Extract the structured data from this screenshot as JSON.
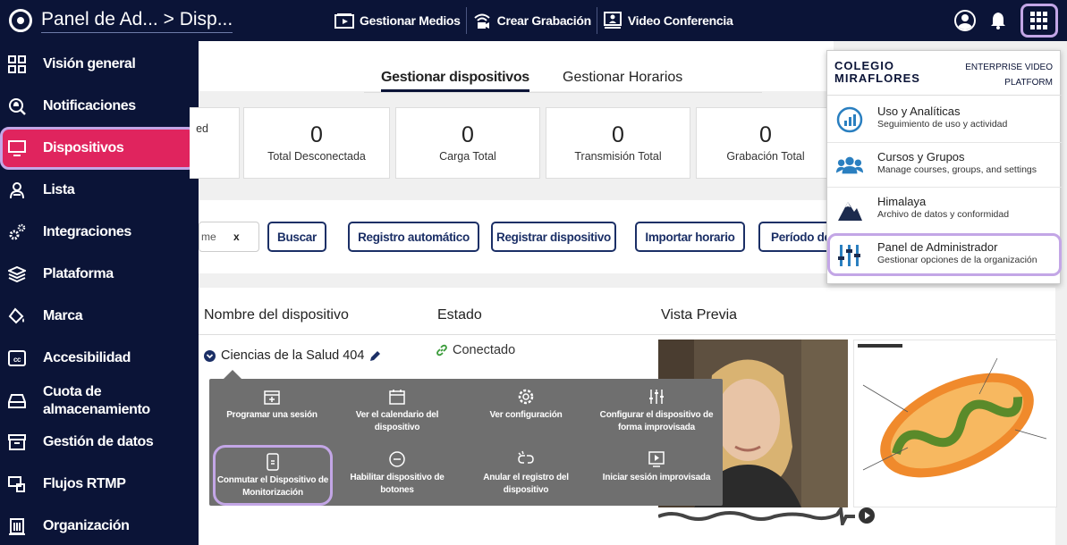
{
  "header": {
    "brand_title": "Panel de Ad...  > Disp...",
    "links": [
      "Gestionar Medios",
      "Crear Grabación",
      "Video Conferencia"
    ]
  },
  "sidebar": {
    "items": [
      {
        "label": "Visión general",
        "icon": "grid-icon"
      },
      {
        "label": "Notificaciones",
        "icon": "bell-search-icon"
      },
      {
        "label": "Dispositivos",
        "icon": "monitor-icon"
      },
      {
        "label": "Lista",
        "icon": "roster-icon"
      },
      {
        "label": "Integraciones",
        "icon": "gears-icon"
      },
      {
        "label": "Plataforma",
        "icon": "layers-icon"
      },
      {
        "label": "Marca",
        "icon": "paint-icon"
      },
      {
        "label": "Accesibilidad",
        "icon": "cc-icon"
      },
      {
        "label": "Cuota de almacenamiento",
        "icon": "drive-icon"
      },
      {
        "label": "Gestión de datos",
        "icon": "archive-icon"
      },
      {
        "label": "Flujos RTMP",
        "icon": "stream-icon"
      },
      {
        "label": "Organización",
        "icon": "building-icon"
      }
    ],
    "active_index": 2
  },
  "tabs": [
    "Gestionar dispositivos",
    "Gestionar Horarios"
  ],
  "stats": [
    {
      "value": "",
      "label": "ed"
    },
    {
      "value": "0",
      "label": "Total Desconectada"
    },
    {
      "value": "0",
      "label": "Carga Total"
    },
    {
      "value": "0",
      "label": "Transmisión Total"
    },
    {
      "value": "0",
      "label": "Grabación Total"
    }
  ],
  "filter_chip": {
    "text": "me",
    "clear": "x"
  },
  "buttons": [
    "Buscar",
    "Registro automático",
    "Registrar dispositivo",
    "Importar horario",
    "Período de"
  ],
  "table": {
    "headers": [
      "Nombre del dispositivo",
      "Estado",
      "Vista Previa"
    ],
    "row": {
      "name": "Ciencias de la Salud 404",
      "status": "Conectado"
    }
  },
  "popover": {
    "items": [
      {
        "label": "Programar una sesión",
        "icon": "calendar-plus-icon"
      },
      {
        "label": "Ver el calendario del dispositivo",
        "icon": "calendar-icon"
      },
      {
        "label": "Ver configuración",
        "icon": "gear-icon"
      },
      {
        "label": "Configurar el dispositivo de forma improvisada",
        "icon": "sliders-icon"
      },
      {
        "label": "Conmutar el Dispositivo de Monitorización",
        "icon": "phone-icon"
      },
      {
        "label": "Habilitar dispositivo de botones",
        "icon": "minus-circle-icon"
      },
      {
        "label": "Anular el registro del dispositivo",
        "icon": "unlink-icon"
      },
      {
        "label": "Iniciar sesión improvisada",
        "icon": "play-screen-icon"
      }
    ],
    "highlight_index": 4
  },
  "apps_menu": {
    "logo_line1": "COLEGIO",
    "logo_line2": "MIRAFLORES",
    "platform_line1": "ENTERPRISE VIDEO",
    "platform_line2": "PLATFORM",
    "items": [
      {
        "title": "Uso y Analíticas",
        "subtitle": "Seguimiento de uso y actividad",
        "icon": "analytics-icon"
      },
      {
        "title": "Cursos y Grupos",
        "subtitle": "Manage courses, groups, and settings",
        "icon": "users-icon"
      },
      {
        "title": "Himalaya",
        "subtitle": "Archivo de datos y conformidad",
        "icon": "mountain-icon"
      },
      {
        "title": "Panel de Administrador",
        "subtitle": "Gestionar opciones de la organización",
        "icon": "admin-sliders-icon"
      }
    ],
    "highlight_index": 3
  },
  "colors": {
    "navy": "#0b1437",
    "active": "#e0245e",
    "highlight": "#c3a6e6"
  }
}
